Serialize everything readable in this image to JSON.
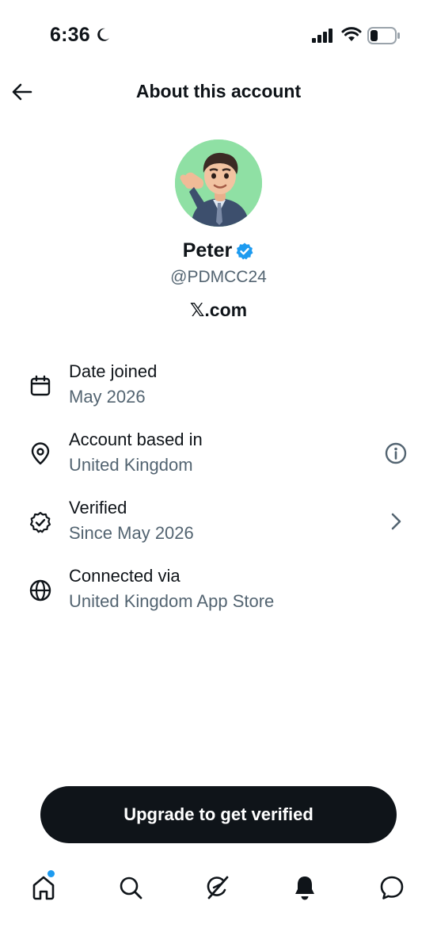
{
  "status_bar": {
    "time": "6:36",
    "icons": [
      "moon-icon",
      "signal-icon",
      "wifi-icon",
      "battery-icon"
    ]
  },
  "header": {
    "title": "About this account",
    "back_icon": "back-arrow-icon"
  },
  "profile": {
    "name": "Peter",
    "handle": "@PDMCC24",
    "platform_x": "𝕏",
    "platform_rest": ".com",
    "verified_color": "#1d9bf0"
  },
  "info": {
    "date_joined": {
      "title": "Date joined",
      "value": "May 2026",
      "icon": "calendar-icon"
    },
    "based_in": {
      "title": "Account based in",
      "value": "United Kingdom",
      "icon": "location-pin-icon",
      "action_icon": "info-icon"
    },
    "verified": {
      "title": "Verified",
      "value": "Since May 2026",
      "icon": "verified-seal-icon",
      "action_icon": "chevron-right-icon"
    },
    "connected": {
      "title": "Connected via",
      "value": "United Kingdom App Store",
      "icon": "globe-icon"
    }
  },
  "cta": {
    "label": "Upgrade to get verified"
  },
  "tabs": [
    {
      "name": "home",
      "icon": "home-icon",
      "has_dot": true
    },
    {
      "name": "search",
      "icon": "search-icon"
    },
    {
      "name": "grok",
      "icon": "grok-icon"
    },
    {
      "name": "notifications",
      "icon": "bell-icon"
    },
    {
      "name": "messages",
      "icon": "message-icon"
    }
  ],
  "colors": {
    "text_primary": "#0f1419",
    "text_secondary": "#536471",
    "accent": "#1d9bf0",
    "avatar_bg": "#8fe0a4"
  }
}
